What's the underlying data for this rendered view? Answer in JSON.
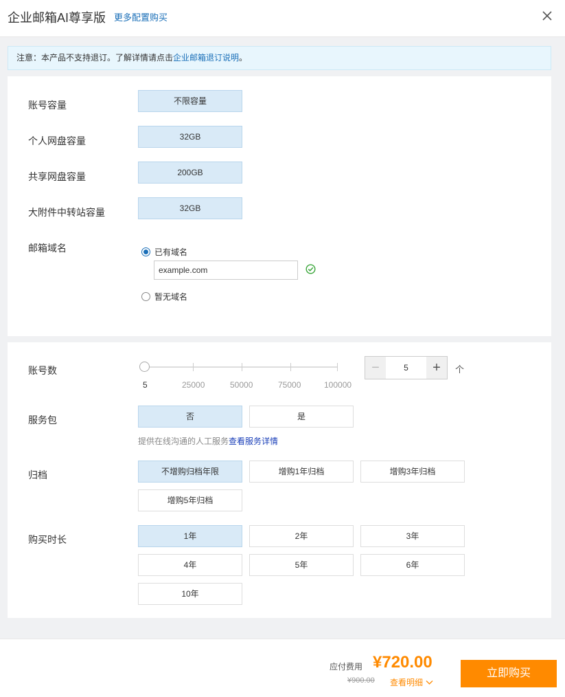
{
  "header": {
    "title": "企业邮箱AI尊享版",
    "more_link": "更多配置购买"
  },
  "notice": {
    "prefix": "注意：本产品不支持退订。了解详情请点击",
    "link": "企业邮箱退订说明",
    "suffix": "。"
  },
  "specs": [
    {
      "label": "账号容量",
      "value": "不限容量"
    },
    {
      "label": "个人网盘容量",
      "value": "32GB"
    },
    {
      "label": "共享网盘容量",
      "value": "200GB"
    },
    {
      "label": "大附件中转站容量",
      "value": "32GB"
    }
  ],
  "domain": {
    "label": "邮箱域名",
    "option_has": "已有域名",
    "option_none": "暂无域名",
    "selected": "已有域名",
    "input_value": "example.com"
  },
  "accounts": {
    "label": "账号数",
    "slider_labels": [
      "5",
      "25000",
      "50000",
      "75000",
      "100000"
    ],
    "value": "5",
    "unit": "个"
  },
  "service": {
    "label": "服务包",
    "options": [
      "否",
      "是"
    ],
    "selected": "否",
    "note": "提供在线沟通的人工服务",
    "note_link": "查看服务详情"
  },
  "archive": {
    "label": "归档",
    "options": [
      "不增购归档年限",
      "增购1年归档",
      "增购3年归档",
      "增购5年归档"
    ],
    "selected": "不增购归档年限"
  },
  "duration": {
    "label": "购买时长",
    "options": [
      "1年",
      "2年",
      "3年",
      "4年",
      "5年",
      "6年",
      "10年"
    ],
    "selected": "1年"
  },
  "footer": {
    "fee_label": "应付费用",
    "price": "¥720.00",
    "original_price": "¥900.00",
    "detail_link": "查看明细",
    "buy_button": "立即购买"
  },
  "colors": {
    "accent": "#ff8a00",
    "link": "#1a6fb8",
    "selected_bg": "#d9eaf7"
  }
}
